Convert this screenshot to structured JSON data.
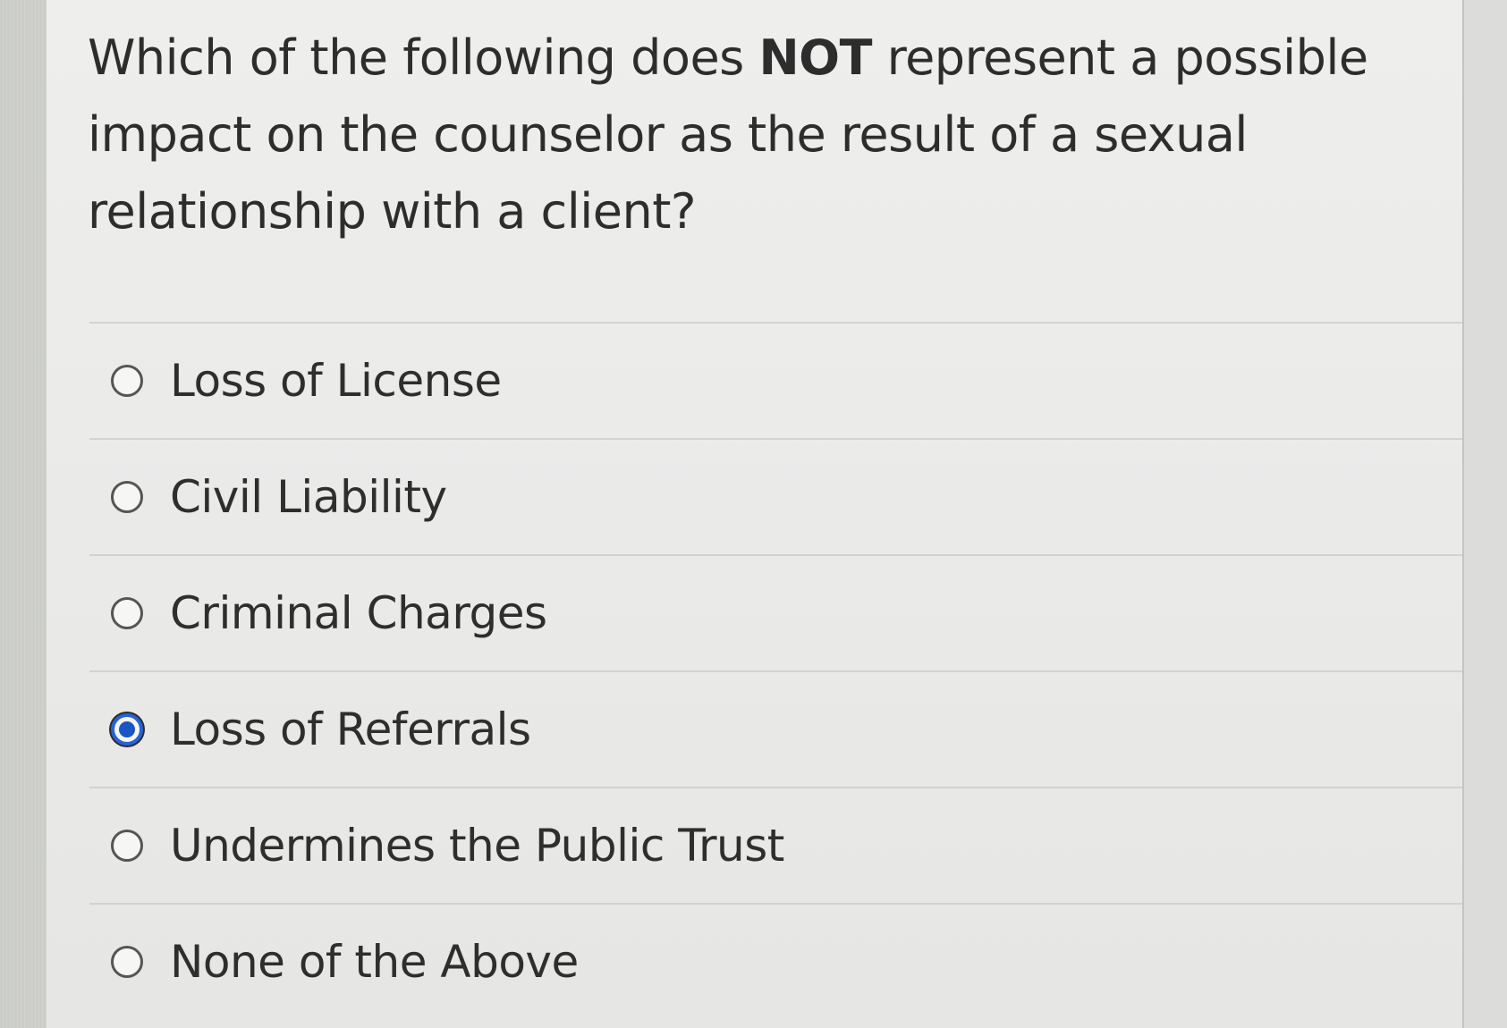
{
  "question": {
    "text_before": "Which of the following does ",
    "emphasis": "NOT",
    "text_after": " represent a possible impact on the counselor as the result of a sexual relationship with a client?"
  },
  "answers": [
    {
      "label": "Loss of License",
      "selected": false
    },
    {
      "label": "Civil Liability",
      "selected": false
    },
    {
      "label": "Criminal Charges",
      "selected": false
    },
    {
      "label": "Loss of Referrals",
      "selected": true
    },
    {
      "label": "Undermines the Public Trust",
      "selected": false
    },
    {
      "label": "None of the Above",
      "selected": false
    }
  ],
  "colors": {
    "selected_radio": "#1a56c4",
    "text": "#2e2e2e",
    "panel_background": "#ececea"
  }
}
